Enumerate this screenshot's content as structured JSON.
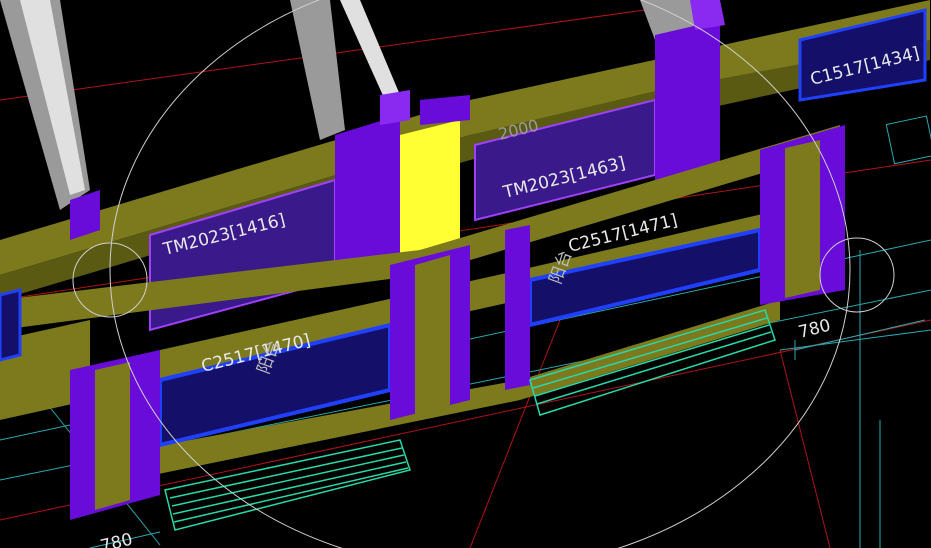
{
  "viewport": {
    "background": "#000000",
    "colors": {
      "beam": "#7c7a1c",
      "beam_dark": "#5b5a12",
      "column": "#6a0cd9",
      "column_light": "#8a2af0",
      "glass": "#14106a",
      "glass_edge": "#2040ff",
      "frame": "#d8d8d8",
      "highlight": "#ffff33",
      "axis_red": "#c81818",
      "axis_cyan": "#38d8d0",
      "orbit": "#d0d0d0",
      "stair": "#28d8a8"
    }
  },
  "labels": {
    "door_left": "TM2023[1416]",
    "door_right": "TM2023[1463]",
    "window_lower_left": "C2517[1470]",
    "window_lower_right": "C2517[1471]",
    "window_top_right": "C1517[1434]",
    "room_left": "阳台",
    "room_right": "阳台",
    "dim_top": "2000",
    "dim_right": "780",
    "dim_bottom": "780"
  }
}
